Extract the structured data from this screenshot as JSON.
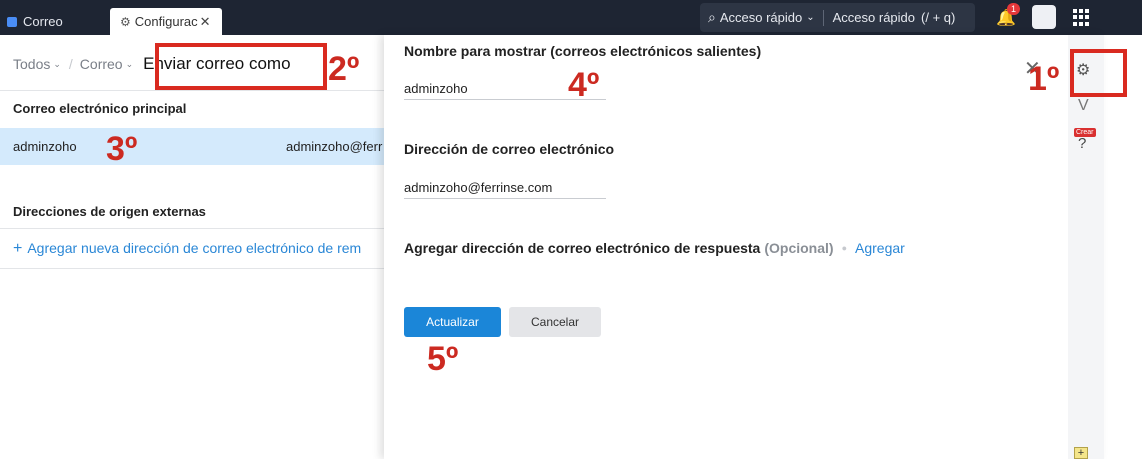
{
  "topbar": {
    "tabs": [
      {
        "label": "Correo"
      },
      {
        "label": "Configurac"
      }
    ],
    "search_placeholder": "Acceso rápido",
    "quick_access": "Acceso rápido",
    "shortcut": "(/ + q)",
    "notification_count": "1"
  },
  "breadcrumb": {
    "items": [
      "Todos",
      "Correo"
    ],
    "current": "Enviar correo como"
  },
  "left": {
    "primary_title": "Correo electrónico principal",
    "primary_name": "adminzoho",
    "primary_email": "adminzoho@ferr",
    "external_title": "Direcciones de origen externas",
    "add_link": "Agregar nueva dirección de correo electrónico de rem"
  },
  "form": {
    "display_name_label": "Nombre para mostrar (correos electrónicos salientes)",
    "display_name_value": "adminzoho",
    "email_label": "Dirección de correo electrónico",
    "email_value": "adminzoho@ferrinse.com",
    "reply_label": "Agregar dirección de correo electrónico de respuesta",
    "reply_optional": "(Opcional)",
    "reply_add": "Agregar",
    "update_button": "Actualizar",
    "cancel_button": "Cancelar"
  },
  "rail": {
    "crear_label": "Crear"
  },
  "annotations": {
    "step1": "1º",
    "step2": "2º",
    "step3": "3º",
    "step4": "4º",
    "step5": "5º",
    "color": "#d92a20"
  }
}
